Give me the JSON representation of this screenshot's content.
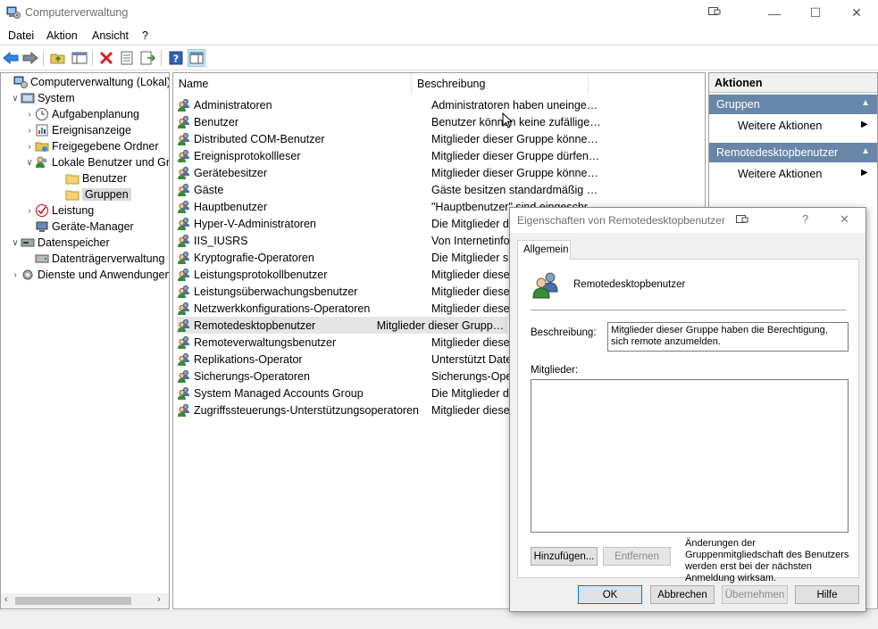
{
  "window": {
    "title": "Computerverwaltung",
    "controls": [
      "—",
      "☐",
      "✕"
    ]
  },
  "menu": [
    "Datei",
    "Aktion",
    "Ansicht",
    "?"
  ],
  "tree": {
    "items": [
      {
        "label": "Computerverwaltung (Lokal)",
        "expander": "",
        "icon": "computer-management-icon"
      },
      {
        "label": "System",
        "expander": "∨",
        "icon": "system-tools-icon"
      },
      {
        "label": "Aufgabenplanung",
        "expander": "›",
        "icon": "task-scheduler-icon"
      },
      {
        "label": "Ereignisanzeige",
        "expander": "›",
        "icon": "event-viewer-icon"
      },
      {
        "label": "Freigegebene Ordner",
        "expander": "›",
        "icon": "shared-folders-icon"
      },
      {
        "label": "Lokale Benutzer und Gr",
        "expander": "∨",
        "icon": "local-users-icon"
      },
      {
        "label": "Benutzer",
        "expander": "",
        "icon": "folder-icon"
      },
      {
        "label": "Gruppen",
        "expander": "",
        "icon": "folder-icon"
      },
      {
        "label": "Leistung",
        "expander": "›",
        "icon": "performance-icon"
      },
      {
        "label": "Geräte-Manager",
        "expander": "",
        "icon": "device-manager-icon"
      },
      {
        "label": "Datenspeicher",
        "expander": "∨",
        "icon": "storage-icon"
      },
      {
        "label": "Datenträgerverwaltung",
        "expander": "",
        "icon": "disk-management-icon"
      },
      {
        "label": "Dienste und Anwendungen",
        "expander": "›",
        "icon": "services-icon"
      }
    ]
  },
  "list": {
    "columns": [
      "Name",
      "Beschreibung"
    ],
    "rows": [
      {
        "name": "Administratoren",
        "desc": "Administratoren haben uneingesc..."
      },
      {
        "name": "Benutzer",
        "desc": "Benutzer können keine zufälligen ..."
      },
      {
        "name": "Distributed COM-Benutzer",
        "desc": "Mitglieder dieser Gruppe können ..."
      },
      {
        "name": "Ereignisprotokollleser",
        "desc": "Mitglieder dieser Gruppe dürfen E..."
      },
      {
        "name": "Gerätebesitzer",
        "desc": "Mitglieder dieser Gruppe können ..."
      },
      {
        "name": "Gäste",
        "desc": "Gäste besitzen standardmäßig die..."
      },
      {
        "name": "Hauptbenutzer",
        "desc": "\"Hauptbenutzer\" sind eingeschr..."
      },
      {
        "name": "Hyper-V-Administratoren",
        "desc": "Die Mitglieder dieser Gruppe erh..."
      },
      {
        "name": "IIS_IUSRS",
        "desc": "Von Internetinformationsdiensten..."
      },
      {
        "name": "Kryptografie-Operatoren",
        "desc": "Die Mitglieder sind berechtigt, k..."
      },
      {
        "name": "Leistungsprotokollbenutzer",
        "desc": "Mitglieder dieser Gruppe können ..."
      },
      {
        "name": "Leistungsüberwachungsbenutzer",
        "desc": "Mitglieder dieser Gruppe können ..."
      },
      {
        "name": "Netzwerkkonfigurations-Operatoren",
        "desc": "Mitglieder dieser Gruppe können ..."
      },
      {
        "name": "Remotedesktopbenutzer",
        "desc": "Mitglieder dieser Gruppe haben d..."
      },
      {
        "name": "Remoteverwaltungsbenutzer",
        "desc": "Mitglieder dieser Gruppe können ..."
      },
      {
        "name": "Replikations-Operator",
        "desc": "Unterstützt Dateireplikation in e..."
      },
      {
        "name": "Sicherungs-Operatoren",
        "desc": "Sicherungs-Operatoren können Si..."
      },
      {
        "name": "System Managed Accounts Group",
        "desc": "Die Mitglieder dieser Gruppe we..."
      },
      {
        "name": "Zugriffssteuerungs-Unterstützungsoperatoren",
        "desc": "Mitglieder dieser Gruppe können ..."
      }
    ]
  },
  "actions": {
    "header": "Aktionen",
    "group1": "Gruppen",
    "group1_item": "Weitere Aktionen",
    "group2": "Remotedesktopbenutzer",
    "group2_item": "Weitere Aktionen"
  },
  "dialog": {
    "title": "Eigenschaften von Remotedesktopbenutzer",
    "help_glyph": "?",
    "close_glyph": "✕",
    "tab": "Allgemein",
    "group_name": "Remotedesktopbenutzer",
    "desc_label": "Beschreibung:",
    "desc_value": "Mitglieder dieser Gruppe haben die Berechtigung, sich remote anzumelden.",
    "members_label": "Mitglieder:",
    "add_button": "Hinzufügen...",
    "remove_button": "Entfernen",
    "note": "Änderungen der Gruppenmitgliedschaft des Benutzers werden erst bei der nächsten Anmeldung wirksam.",
    "ok": "OK",
    "cancel": "Abbrechen",
    "apply": "Übernehmen",
    "help": "Hilfe"
  }
}
